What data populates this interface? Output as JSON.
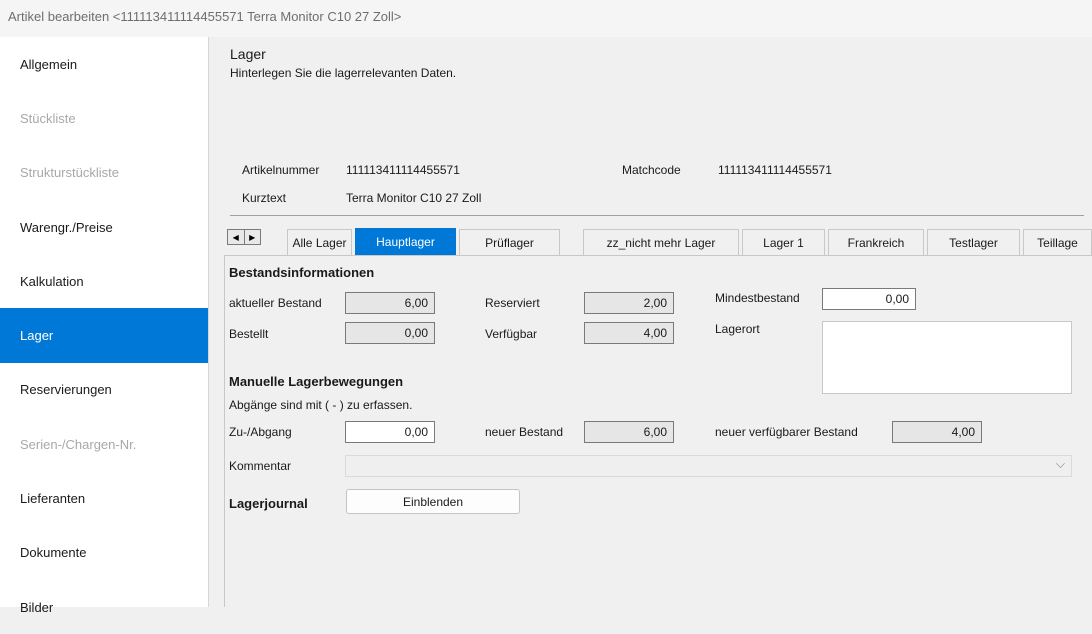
{
  "window": {
    "title": "Artikel bearbeiten <111113411114455571 Terra Monitor C10 27 Zoll>"
  },
  "sidebar": {
    "items": [
      {
        "label": "Allgemein",
        "state": "normal"
      },
      {
        "label": "Stückliste",
        "state": "disabled"
      },
      {
        "label": "Strukturstückliste",
        "state": "disabled"
      },
      {
        "label": "Warengr./Preise",
        "state": "normal"
      },
      {
        "label": "Kalkulation",
        "state": "normal"
      },
      {
        "label": "Lager",
        "state": "active"
      },
      {
        "label": "Reservierungen",
        "state": "normal"
      },
      {
        "label": "Serien-/Chargen-Nr.",
        "state": "disabled"
      },
      {
        "label": "Lieferanten",
        "state": "normal"
      },
      {
        "label": "Dokumente",
        "state": "normal"
      },
      {
        "label": "Bilder",
        "state": "normal"
      }
    ]
  },
  "header": {
    "title": "Lager",
    "subtitle": "Hinterlegen Sie die lagerrelevanten Daten."
  },
  "article": {
    "number_label": "Artikelnummer",
    "number_value": "111113411114455571",
    "matchcode_label": "Matchcode",
    "matchcode_value": "111113411114455571",
    "shorttext_label": "Kurztext",
    "shorttext_value": "Terra Monitor C10 27 Zoll"
  },
  "tabs": {
    "items": [
      "Alle Lager",
      "Hauptlager",
      "Prüflager",
      "zz_nicht mehr Lager",
      "Lager 1",
      "Frankreich",
      "Testlager",
      "Teillage"
    ],
    "active": "Hauptlager"
  },
  "stock": {
    "heading": "Bestandsinformationen",
    "current_label": "aktueller Bestand",
    "current_value": "6,00",
    "ordered_label": "Bestellt",
    "ordered_value": "0,00",
    "reserved_label": "Reserviert",
    "reserved_value": "2,00",
    "available_label": "Verfügbar",
    "available_value": "4,00",
    "minimum_label": "Mindestbestand",
    "minimum_value": "0,00",
    "location_label": "Lagerort",
    "location_value": ""
  },
  "movements": {
    "heading": "Manuelle Lagerbewegungen",
    "hint": "Abgänge sind mit ( - ) zu erfassen.",
    "change_label": "Zu-/Abgang",
    "change_value": "0,00",
    "new_stock_label": "neuer Bestand",
    "new_stock_value": "6,00",
    "new_available_label": "neuer verfügbarer Bestand",
    "new_available_value": "4,00",
    "comment_label": "Kommentar",
    "comment_value": ""
  },
  "journal": {
    "heading": "Lagerjournal",
    "button_label": "Einblenden"
  },
  "colors": {
    "accent": "#0078d7",
    "sidebar_bg": "#ffffff",
    "panel_bg": "#f0f0f0"
  }
}
